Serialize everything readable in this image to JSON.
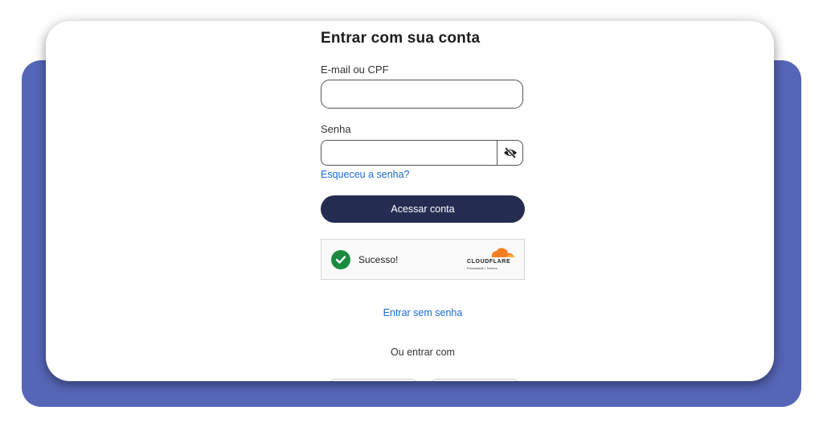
{
  "login": {
    "title": "Entrar com sua conta",
    "email_label": "E-mail ou CPF",
    "email_value": "",
    "password_label": "Senha",
    "password_value": "",
    "toggle_icon": "eye-slash-icon",
    "forgot_link": "Esqueceu a senha?",
    "submit_label": "Acessar conta",
    "captcha": {
      "status": "Sucesso!",
      "status_icon": "check-circle-icon",
      "provider": "CLOUDFLARE",
      "provider_sub": "Privacidade • Termos"
    },
    "passwordless_link": "Entrar sem senha",
    "alt_login_text": "Ou entrar com"
  },
  "colors": {
    "backdrop": "#5566b8",
    "button": "#252c52",
    "link": "#1a6bd6",
    "success": "#1a8a3f",
    "cloudflare": "#f38020"
  }
}
